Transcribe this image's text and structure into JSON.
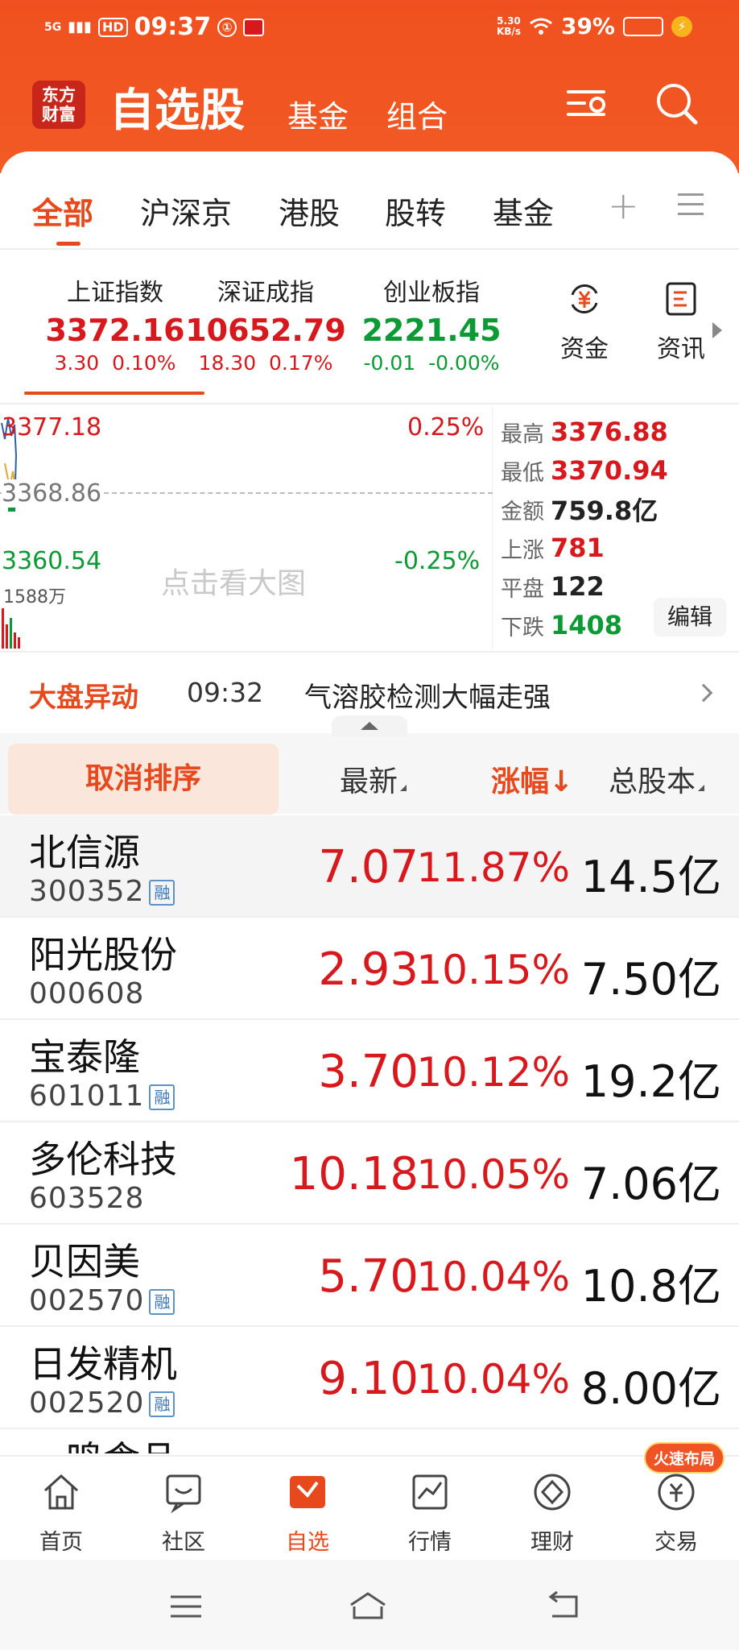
{
  "status_bar": {
    "network": "5G",
    "hd": "HD",
    "time": "09:37",
    "info_glyph": "①",
    "net_speed_value": "5.30",
    "net_speed_unit": "KB/s",
    "battery": "39%",
    "battery_level": 0.39
  },
  "header": {
    "logo": [
      "东方",
      "财富"
    ],
    "title": "自选股",
    "tabs": [
      "基金",
      "组合"
    ],
    "icons": [
      "settings-icon",
      "search-icon"
    ]
  },
  "category_tabs": {
    "items": [
      "全部",
      "沪深京",
      "港股",
      "股转",
      "基金"
    ],
    "active": "全部",
    "plus": "+"
  },
  "indices": [
    {
      "name": "上证指数",
      "value": "3372.16",
      "change": "3.30",
      "percent": "0.10%",
      "color": "#d7181c"
    },
    {
      "name": "深证成指",
      "value": "10652.79",
      "change": "18.30",
      "percent": "0.17%",
      "color": "#d7181c"
    },
    {
      "name": "创业板指",
      "value": "2221.45",
      "change": "-0.01",
      "percent": "-0.00%",
      "color": "#0b9a34"
    }
  ],
  "quick_links": [
    {
      "label": "资金",
      "icon": "yuan-cycle-icon"
    },
    {
      "label": "资讯",
      "icon": "document-icon"
    }
  ],
  "mini_chart": {
    "high": "3377.18",
    "mid": "3368.86",
    "low": "3360.54",
    "high_pct": "0.25%",
    "low_pct": "-0.25%",
    "volume": "1588万",
    "hint": "点击看大图"
  },
  "stats": [
    {
      "label": "最高",
      "value": "3376.88",
      "color": "#d7181c"
    },
    {
      "label": "最低",
      "value": "3370.94",
      "color": "#d7181c"
    },
    {
      "label": "金额",
      "value": "759.8亿",
      "color": "#222222"
    },
    {
      "label": "上涨",
      "value": "781",
      "color": "#d7181c"
    },
    {
      "label": "平盘",
      "value": "122",
      "color": "#222222"
    },
    {
      "label": "下跌",
      "value": "1408",
      "color": "#0b9a34"
    }
  ],
  "edit_label": "编辑",
  "news": {
    "tag": "大盘异动",
    "time": "09:32",
    "text": "气溶胶检测大幅走强"
  },
  "sort_header": {
    "cancel": "取消排序",
    "latest": "最新",
    "change_pct": "涨幅↓",
    "total_shares": "总股本"
  },
  "stocks": [
    {
      "name": "北信源",
      "code": "300352",
      "margin": true,
      "price": "7.07",
      "pct": "11.87%",
      "shares": "14.5亿"
    },
    {
      "name": "阳光股份",
      "code": "000608",
      "margin": false,
      "price": "2.93",
      "pct": "10.15%",
      "shares": "7.50亿"
    },
    {
      "name": "宝泰隆",
      "code": "601011",
      "margin": true,
      "price": "3.70",
      "pct": "10.12%",
      "shares": "19.2亿"
    },
    {
      "name": "多伦科技",
      "code": "603528",
      "margin": false,
      "price": "10.18",
      "pct": "10.05%",
      "shares": "7.06亿"
    },
    {
      "name": "贝因美",
      "code": "002570",
      "margin": true,
      "price": "5.70",
      "pct": "10.04%",
      "shares": "10.8亿"
    },
    {
      "name": "日发精机",
      "code": "002520",
      "margin": true,
      "price": "9.10",
      "pct": "10.04%",
      "shares": "8.00亿"
    }
  ],
  "margin_badge": "融",
  "partial_row_name": "一鸣食品",
  "bottom_nav": {
    "items": [
      {
        "label": "首页",
        "icon": "home-icon"
      },
      {
        "label": "社区",
        "icon": "community-icon"
      },
      {
        "label": "自选",
        "icon": "watchlist-icon"
      },
      {
        "label": "行情",
        "icon": "market-icon"
      },
      {
        "label": "理财",
        "icon": "wealth-icon"
      },
      {
        "label": "交易",
        "icon": "trade-icon"
      }
    ],
    "active": "自选",
    "badge": "火速布局"
  },
  "colors": {
    "brand": "#f0501f",
    "accent": "#e8491c",
    "up": "#d7181c",
    "down": "#0b9a34"
  }
}
